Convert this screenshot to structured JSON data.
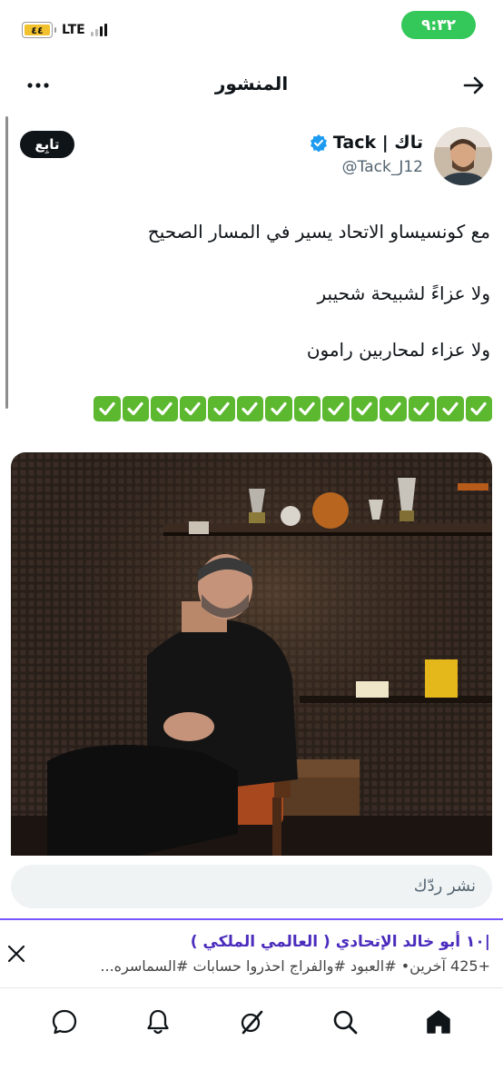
{
  "status_bar": {
    "time": "٩:٣٢",
    "battery": "٤٤",
    "network": "LTE"
  },
  "header": {
    "title": "المنشور"
  },
  "post": {
    "author_name": "تاك | Tack",
    "handle": "@Tack_J12",
    "follow_label": "تابِع",
    "lines": [
      "مع كونسيساو الاتحاد يسير في المسار الصحيح",
      "ولا عزاءً لشبيحة شحيبر",
      "ولا عزاء لمحاربين رامون"
    ],
    "check_count": 14
  },
  "reply": {
    "placeholder": "نشر ردّك"
  },
  "notification": {
    "title": "|١٠ أبو خالد الإتحادي ( العالمي الملكي )",
    "subtitle": "+425 آخرين• #العبود #والفراج احذروا حسابات #السماسره..."
  },
  "icons": {
    "back": "arrow-right-icon",
    "more": "more-dots-icon",
    "verified": "verified-badge-icon",
    "close": "close-icon",
    "nav": [
      "chat-icon",
      "bell-icon",
      "grok-icon",
      "search-icon",
      "home-icon"
    ]
  },
  "colors": {
    "clock_pill": "#34c759",
    "verified": "#1d9bf0",
    "check_emoji": "#5cb82e",
    "banner_accent": "#7856ff",
    "banner_title": "#4b2cbd"
  }
}
